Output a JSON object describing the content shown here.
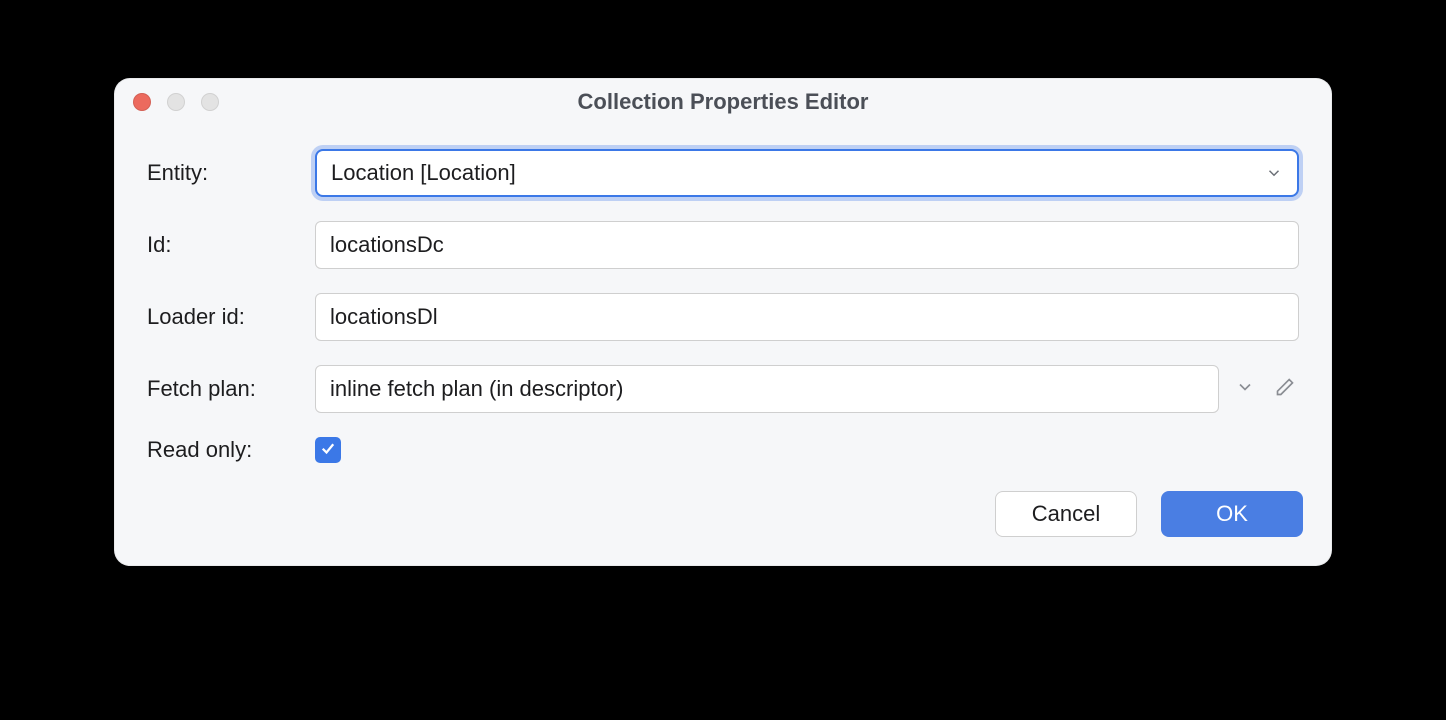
{
  "dialog": {
    "title": "Collection Properties Editor"
  },
  "labels": {
    "entity": "Entity:",
    "id": "Id:",
    "loader_id": "Loader id:",
    "fetch_plan": "Fetch plan:",
    "read_only": "Read only:"
  },
  "fields": {
    "entity_value": "Location [Location]",
    "id_value": "locationsDc",
    "loader_id_value": "locationsDl",
    "fetch_plan_value": "inline fetch plan (in descriptor)",
    "read_only_checked": true
  },
  "buttons": {
    "cancel": "Cancel",
    "ok": "OK"
  }
}
